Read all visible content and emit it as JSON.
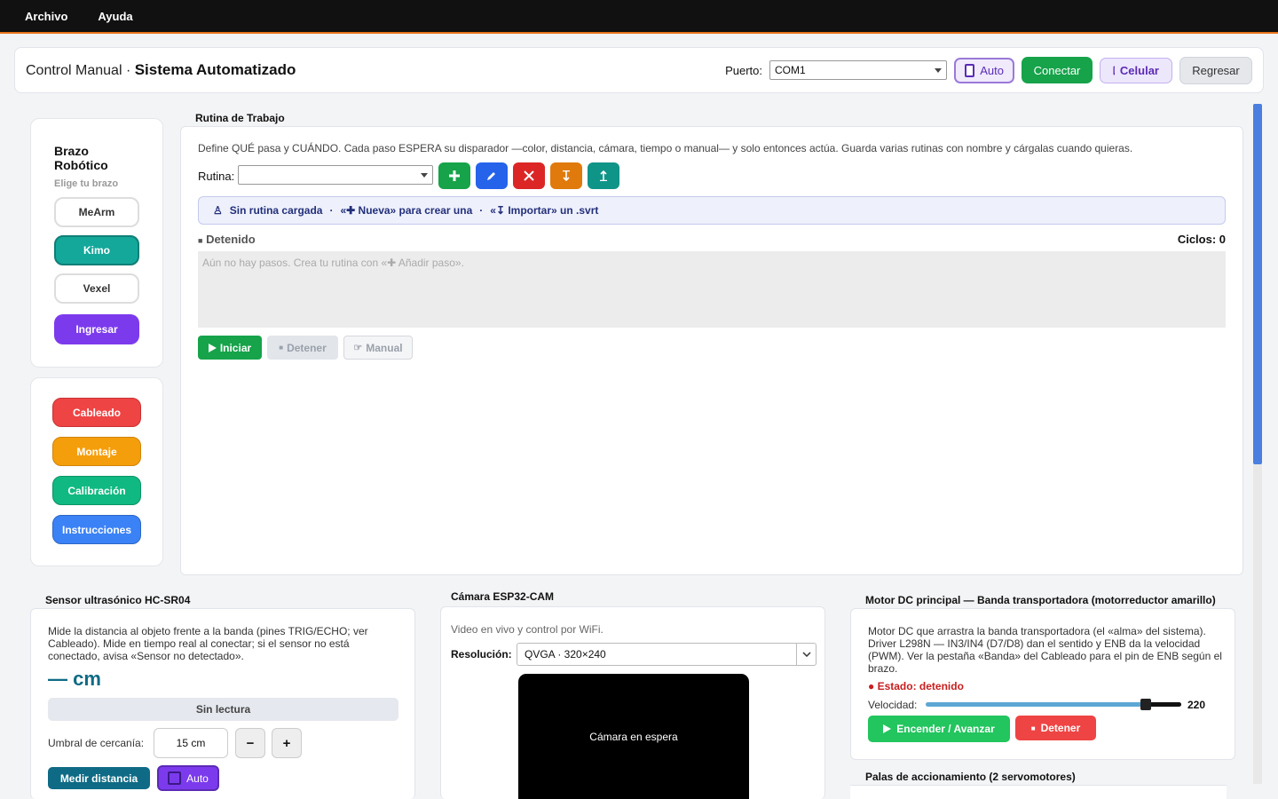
{
  "menu": {
    "file": "Archivo",
    "help": "Ayuda"
  },
  "header": {
    "title_prefix": "Control Manual · ",
    "title_main": "Sistema Automatizado",
    "port_label": "Puerto:",
    "port_value": "COM1",
    "auto_label": "Auto",
    "connect_label": "Conectar",
    "phone_label": "Celular",
    "back_label": "Regresar"
  },
  "arm_panel": {
    "title_line1": "Brazo",
    "title_line2": "Robótico",
    "subtitle": "Elige tu brazo",
    "arms": [
      "MeArm",
      "Kimo",
      "Vexel"
    ],
    "selected": "Kimo",
    "login_label": "Ingresar"
  },
  "nav": {
    "wiring": "Cableado",
    "assembly": "Montaje",
    "calibration": "Calibración",
    "instructions": "Instrucciones"
  },
  "routine": {
    "section_title": "Rutina de Trabajo",
    "description": "Define QUÉ pasa y CUÁNDO. Cada paso ESPERA su disparador —color, distancia, cámara, tiempo o manual— y solo entonces actúa. Guarda varias rutinas con nombre y cárgalas cuando quieras.",
    "select_label": "Rutina:",
    "select_value": "",
    "banner_none": "Sin rutina cargada",
    "banner_sep": "·",
    "banner_new": "«✚ Nueva» para crear una",
    "banner_import": "«↧ Importar» un .svrt",
    "state_label": "Detenido",
    "cycles_label": "Ciclos: 0",
    "empty_steps": "Aún no hay pasos. Crea tu rutina con «✚ Añadir paso».",
    "start_label": "Iniciar",
    "stop_label": "Detener",
    "manual_label": "Manual"
  },
  "ultrasonic": {
    "title": "Sensor ultrasónico HC-SR04",
    "description": "Mide la distancia al objeto frente a la banda (pines TRIG/ECHO; ver Cableado). Mide en tiempo real al conectar; si el sensor no está conectado, avisa «Sensor no detectado».",
    "reading": "— cm",
    "status": "Sin lectura",
    "threshold_label": "Umbral de cercanía:",
    "threshold_value": "15 cm",
    "minus": "−",
    "plus": "+",
    "measure_label": "Medir distancia",
    "auto_label": "Auto"
  },
  "camera": {
    "title": "Cámara ESP32-CAM",
    "description": "Video en vivo y control por WiFi.",
    "resolution_label": "Resolución:",
    "resolution_value": "QVGA · 320×240",
    "standby": "Cámara en espera"
  },
  "motor": {
    "title": "Motor DC principal — Banda transportadora (motorreductor amarillo)",
    "description": "Motor DC que arrastra la banda transportadora (el «alma» del sistema). Driver L298N — IN3/IN4 (D7/D8) dan el sentido y ENB da la velocidad (PWM). Ver la pestaña «Banda» del Cableado para el pin de ENB según el brazo.",
    "state": "● Estado: detenido",
    "speed_label": "Velocidad:",
    "speed_value": "220",
    "speed_fraction": 0.8627,
    "on_label": "Encender / Avanzar",
    "stop_label": "Detener"
  },
  "paddles": {
    "title": "Palas de accionamiento (2 servomotores)"
  },
  "colors": {
    "accent_orange": "#e8741c",
    "green": "#16a34a",
    "teal": "#14a89b",
    "purple": "#7c3aed",
    "red": "#ef4444",
    "amber": "#f59e0b",
    "emerald": "#10b981",
    "blue": "#3b82f6"
  }
}
